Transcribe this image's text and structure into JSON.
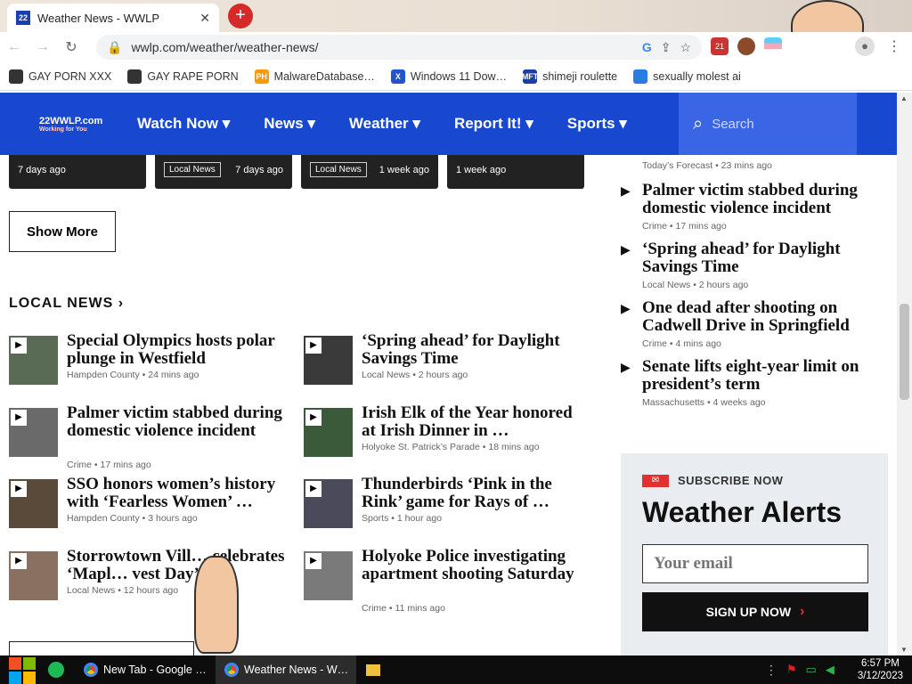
{
  "browser": {
    "tab_title": "Weather News - WWLP",
    "tab_favicon": "22",
    "tab_close": "✕",
    "new_tab": "+",
    "url": "wwlp.com/weather/weather-news/",
    "extension_badge": "21"
  },
  "bookmarks": [
    {
      "label": "GAY PORN XXX",
      "icon": "paw-icon",
      "color": "#333333"
    },
    {
      "label": "GAY RAPE PORN",
      "icon": "globe-icon",
      "color": "#333333"
    },
    {
      "label": "MalwareDatabase…",
      "icon": "PH",
      "color": "#ff9900"
    },
    {
      "label": "Windows 11 Dow…",
      "icon": "X",
      "color": "#2255cc"
    },
    {
      "label": "shimeji roulette",
      "icon": "MFT",
      "color": "#1a3fa0"
    },
    {
      "label": "sexually molest ai",
      "icon": "puzzle-icon",
      "color": "#2a7de0"
    }
  ],
  "site": {
    "logo_text": "22WWLP.com",
    "logo_sub": "Working for You",
    "nav": [
      "Watch Now ▾",
      "News ▾",
      "Weather ▾",
      "Report It! ▾",
      "Sports ▾"
    ],
    "search_placeholder": "Search",
    "brand_color": "#1848d0"
  },
  "cards": [
    {
      "tag": "",
      "time": "7 days ago"
    },
    {
      "tag": "Local News",
      "time": "7 days ago"
    },
    {
      "tag": "Local News",
      "time": "1 week ago"
    },
    {
      "tag": "",
      "time": "1 week ago"
    }
  ],
  "show_more": "Show More",
  "local_news_title": "LOCAL NEWS ›",
  "local_news": [
    {
      "headline": "Special Olympics hosts polar plunge in Westfield",
      "meta": "Hampden County • 24 mins ago"
    },
    {
      "headline": "‘Spring ahead’ for Daylight Savings Time",
      "meta": "Local News • 2 hours ago"
    },
    {
      "headline": "Palmer victim stabbed during domestic violence incident",
      "meta": "Crime • 17 mins ago"
    },
    {
      "headline": "Irish Elk of the Year honored at Irish Dinner in …",
      "meta": "Holyoke St. Patrick’s Parade • 18 mins ago"
    },
    {
      "headline": "SSO honors women’s history with ‘Fearless Women’ …",
      "meta": "Hampden County • 3 hours ago"
    },
    {
      "headline": "Thunderbirds ‘Pink in the Rink’ game for Rays of …",
      "meta": "Sports • 1 hour ago"
    },
    {
      "headline": "Storrowtown Vill… celebrates ‘Mapl… vest Day’",
      "meta": "Local News • 12 hours ago"
    },
    {
      "headline": "Holyoke Police investigating apartment shooting Saturday",
      "meta": "Crime • 11 mins ago"
    }
  ],
  "sidebar": {
    "forecast_meta": "Today’s Forecast • 23 mins ago",
    "items": [
      {
        "headline": "Palmer victim stabbed during domestic violence incident",
        "meta": "Crime • 17 mins ago"
      },
      {
        "headline": "‘Spring ahead’ for Daylight Savings Time",
        "meta": "Local News • 2 hours ago"
      },
      {
        "headline": "One dead after shooting on Cadwell Drive in Springfield",
        "meta": "Crime • 4 mins ago"
      },
      {
        "headline": "Senate lifts eight-year limit on president’s term",
        "meta": "Massachusetts • 4 weeks ago"
      }
    ]
  },
  "subscribe": {
    "label": "SUBSCRIBE NOW",
    "title": "Weather Alerts",
    "email_placeholder": "Your email",
    "button": "SIGN UP NOW"
  },
  "taskbar": {
    "items": [
      "New Tab - Google …",
      "Weather News - W…"
    ],
    "time": "6:57 PM",
    "date": "3/12/2023"
  }
}
